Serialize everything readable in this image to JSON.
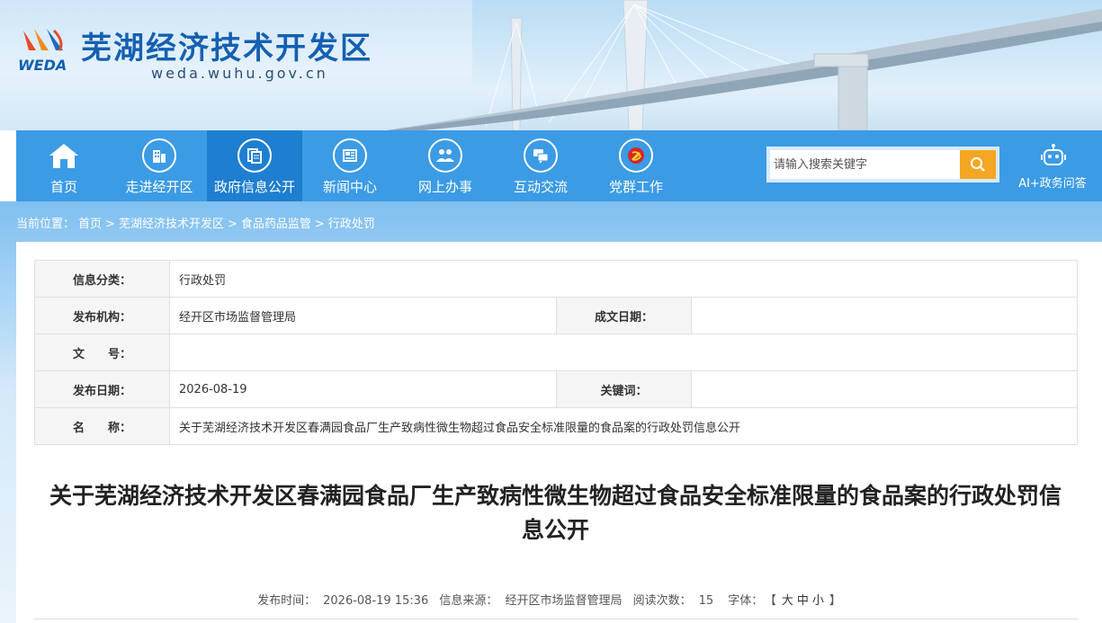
{
  "header": {
    "site_title": "芜湖经济技术开发区",
    "site_url": "weda.wuhu.gov.cn",
    "logo_text": "WEDA"
  },
  "nav": {
    "items": [
      {
        "label": "首页",
        "icon": "home-icon"
      },
      {
        "label": "走进经开区",
        "icon": "building-icon"
      },
      {
        "label": "政府信息公开",
        "icon": "document-icon",
        "active": true
      },
      {
        "label": "新闻中心",
        "icon": "newspaper-icon"
      },
      {
        "label": "网上办事",
        "icon": "people-icon"
      },
      {
        "label": "互动交流",
        "icon": "chat-icon"
      },
      {
        "label": "党群工作",
        "icon": "party-emblem-icon"
      }
    ],
    "search_placeholder": "请输入搜索关键字",
    "ai_label": "AI+政务问答"
  },
  "breadcrumb": {
    "prefix": "当前位置：",
    "items": [
      "首页",
      "芜湖经济技术开发区",
      "食品药品监管",
      "行政处罚"
    ],
    "separator": ">"
  },
  "info": {
    "category_label": "信息分类：",
    "category_value": "行政处罚",
    "publisher_label": "发布机构：",
    "publisher_value": "经开区市场监督管理局",
    "doc_date_label": "成文日期：",
    "doc_date_value": "",
    "doc_no_label": "文　　号：",
    "doc_no_value": "",
    "publish_date_label": "发布日期：",
    "publish_date_value": "2026-08-19",
    "keywords_label": "关键词：",
    "keywords_value": "",
    "name_label": "名　　称：",
    "name_value": "关于芜湖经济技术开发区春满园食品厂生产致病性微生物超过食品安全标准限量的食品案的行政处罚信息公开"
  },
  "article": {
    "title": "关于芜湖经济技术开发区春满园食品厂生产致病性微生物超过食品安全标准限量的食品案的行政处罚信息公开",
    "publish_time_label": "发布时间：",
    "publish_time": "2026-08-19 15:36",
    "source_label": "信息来源：",
    "source": "经开区市场监督管理局",
    "views_label": "阅读次数：",
    "views": "15",
    "font_label": "字体：",
    "font_open": "【",
    "font_large": "大",
    "font_medium": "中",
    "font_small": "小",
    "font_close": "】"
  },
  "colors": {
    "nav_bg": "#3b9be5",
    "nav_active": "#1e7fd0",
    "title_blue": "#1560b2",
    "search_btn": "#f5a623"
  }
}
